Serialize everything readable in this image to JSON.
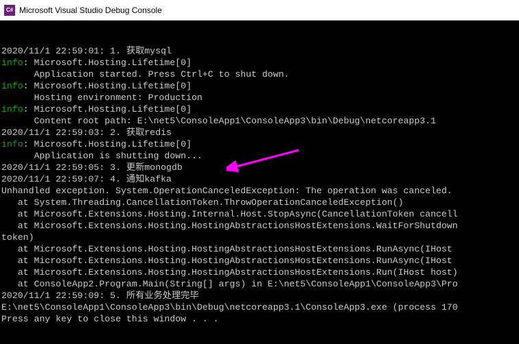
{
  "window": {
    "title": "Microsoft Visual Studio Debug Console",
    "icon_label": "C#"
  },
  "colors": {
    "info": "#00b000",
    "text": "#cccccc",
    "bg": "#000000",
    "arrow": "#ff00ff"
  },
  "lines": [
    {
      "text": "2020/11/1 22:59:01: 1. 获取mysql"
    },
    {
      "prefix": "info",
      "rest": ": Microsoft.Hosting.Lifetime[0]"
    },
    {
      "text": "      Application started. Press Ctrl+C to shut down."
    },
    {
      "prefix": "info",
      "rest": ": Microsoft.Hosting.Lifetime[0]"
    },
    {
      "text": "      Hosting environment: Production"
    },
    {
      "prefix": "info",
      "rest": ": Microsoft.Hosting.Lifetime[0]"
    },
    {
      "text": "      Content root path: E:\\net5\\ConsoleApp1\\ConsoleApp3\\bin\\Debug\\netcoreapp3.1"
    },
    {
      "text": "2020/11/1 22:59:03: 2. 获取redis"
    },
    {
      "prefix": "info",
      "rest": ": Microsoft.Hosting.Lifetime[0]"
    },
    {
      "text": "      Application is shutting down..."
    },
    {
      "text": "2020/11/1 22:59:05: 3. 更新monogdb"
    },
    {
      "text": "2020/11/1 22:59:07: 4. 通知kafka"
    },
    {
      "text": "Unhandled exception. System.OperationCanceledException: The operation was canceled."
    },
    {
      "text": "   at System.Threading.CancellationToken.ThrowOperationCanceledException()"
    },
    {
      "text": "   at Microsoft.Extensions.Hosting.Internal.Host.StopAsync(CancellationToken cancell"
    },
    {
      "text": "   at Microsoft.Extensions.Hosting.HostingAbstractionsHostExtensions.WaitForShutdown"
    },
    {
      "text": "token)"
    },
    {
      "text": "   at Microsoft.Extensions.Hosting.HostingAbstractionsHostExtensions.RunAsync(IHost "
    },
    {
      "text": "   at Microsoft.Extensions.Hosting.HostingAbstractionsHostExtensions.RunAsync(IHost "
    },
    {
      "text": "   at Microsoft.Extensions.Hosting.HostingAbstractionsHostExtensions.Run(IHost host)"
    },
    {
      "text": "   at ConsoleApp2.Program.Main(String[] args) in E:\\net5\\ConsoleApp1\\ConsoleApp3\\Pro"
    },
    {
      "text": "2020/11/1 22:59:09: 5. 所有业务处理完毕"
    },
    {
      "text": ""
    },
    {
      "text": "E:\\net5\\ConsoleApp1\\ConsoleApp3\\bin\\Debug\\netcoreapp3.1\\ConsoleApp3.exe (process 170"
    },
    {
      "text": "Press any key to close this window . . ."
    }
  ],
  "annotation": {
    "arrow_target": "Application is shutting down..."
  }
}
